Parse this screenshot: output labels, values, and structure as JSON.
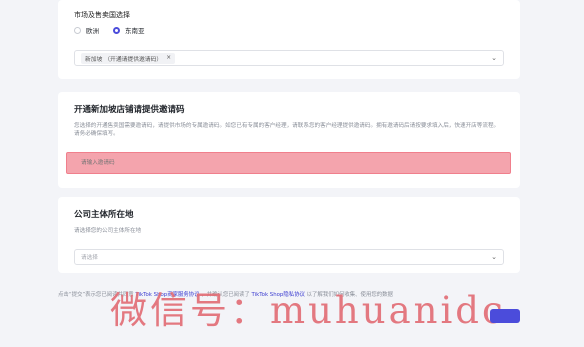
{
  "market": {
    "label": "市场及售卖国选择",
    "options": [
      "欧洲",
      "东南亚"
    ],
    "selected": "东南亚",
    "tag": "新加坡 （开通请提供邀请码）",
    "tag_close": "×",
    "chevron": "⌄"
  },
  "invite": {
    "title": "开通新加坡店铺请提供邀请码",
    "description": "您选择的开通售卖国需要邀请码，请提供市场的专属邀请码。如您已有专属的客户经理，请联系您的客户经理提供邀请码。拥有邀请码后请按要求填入后，快速开店等流程。请务必确保填写。",
    "placeholder": "请输入邀请码"
  },
  "company": {
    "title": "公司主体所在地",
    "subtitle": "请选择您的公司主体所在地",
    "placeholder": "请选择",
    "chevron": "⌄"
  },
  "footer": {
    "prefix": "点击“提交”表示您已阅读并同意",
    "link1": "TikTok Shop商家服务协议",
    "middle": "，并确认您已阅读了",
    "link2": "TikTok Shop隐私协议",
    "suffix": "以了解我们如何收集、使用您的数据"
  },
  "watermark": "微信号：muhuanidc",
  "colors": {
    "accent": "#4b4cdb",
    "highlight": "#f4a4ad"
  }
}
